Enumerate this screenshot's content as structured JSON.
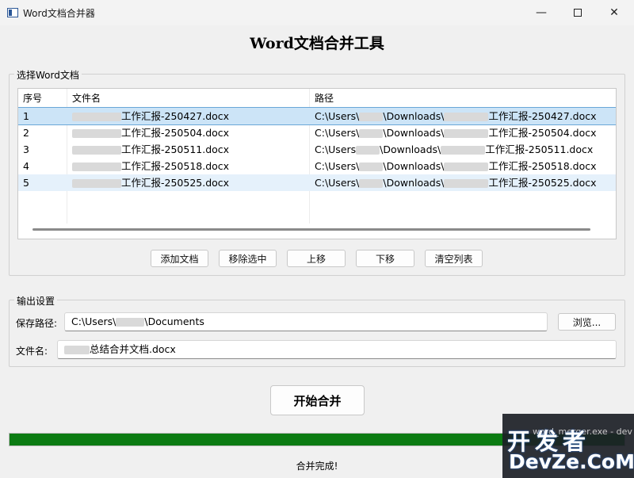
{
  "window": {
    "title": "Word文档合并器",
    "minimize": "—",
    "close": "✕"
  },
  "heading": "Word文档合并工具",
  "select_group": {
    "legend": "选择Word文档",
    "columns": [
      "序号",
      "文件名",
      "路径"
    ],
    "rows": [
      {
        "index": "1",
        "filename": "工作汇报-250427.docx",
        "path_start": "C:\\Users\\",
        "path_mid": "\\Downloads\\",
        "path_end": "工作汇报-250427.docx"
      },
      {
        "index": "2",
        "filename": "工作汇报-250504.docx",
        "path_start": "C:\\Users\\",
        "path_mid": "\\Downloads\\",
        "path_end": "工作汇报-250504.docx"
      },
      {
        "index": "3",
        "filename": "工作汇报-250511.docx",
        "path_start": "C:\\Users",
        "path_mid": "\\Downloads\\",
        "path_end": "工作汇报-250511.docx"
      },
      {
        "index": "4",
        "filename": "工作汇报-250518.docx",
        "path_start": "C:\\Users\\",
        "path_mid": "\\Downloads\\",
        "path_end": "工作汇报-250518.docx"
      },
      {
        "index": "5",
        "filename": "工作汇报-250525.docx",
        "path_start": "C:\\Users\\",
        "path_mid": "\\Downloads\\",
        "path_end": "工作汇报-250525.docx"
      }
    ],
    "buttons": {
      "add": "添加文档",
      "remove": "移除选中",
      "up": "上移",
      "down": "下移",
      "clear": "清空列表"
    }
  },
  "output_group": {
    "legend": "输出设置",
    "save_path_label": "保存路径:",
    "save_path_prefix": "C:\\Users\\",
    "save_path_suffix": "\\Documents",
    "browse": "浏览...",
    "filename_label": "文件名:",
    "filename_value": "总结合并文档.docx"
  },
  "start_button": "开始合并",
  "progress": 1.0,
  "progress_color": "#0b7b12",
  "status": "合并完成!",
  "watermark": {
    "small": "word_merger.exe - dev",
    "line1": "开发者",
    "line2": "DevZe.CoM"
  }
}
